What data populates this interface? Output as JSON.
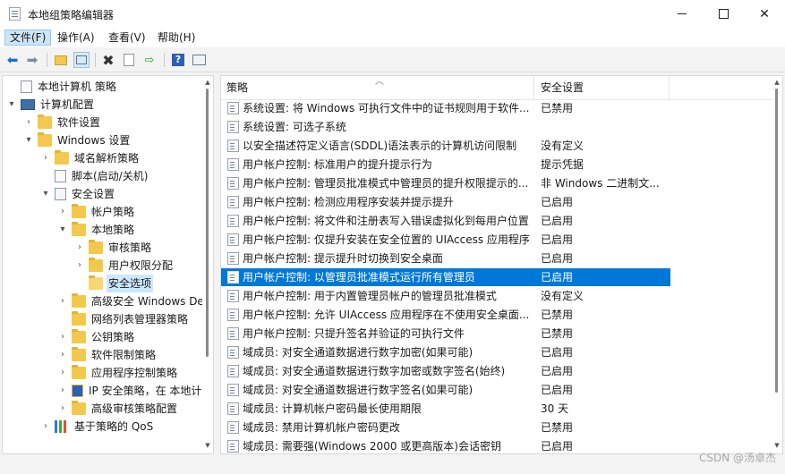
{
  "window": {
    "title": "本地组策略编辑器"
  },
  "menu": [
    "文件(F)",
    "操作(A)",
    "查看(V)",
    "帮助(H)"
  ],
  "toolbar": [
    "back-icon",
    "forward-icon",
    "up-folder-icon",
    "show-tree-icon",
    "delete-icon",
    "properties-icon",
    "export-icon",
    "help-icon",
    "view-icon"
  ],
  "tree": [
    {
      "label": "本地计算机 策略",
      "depth": 0,
      "expander": "",
      "icon": "policy-doc-icon"
    },
    {
      "label": "计算机配置",
      "depth": 0,
      "expander": "▾",
      "icon": "computer-icon"
    },
    {
      "label": "软件设置",
      "depth": 1,
      "expander": "›",
      "icon": "folder-icon"
    },
    {
      "label": "Windows 设置",
      "depth": 1,
      "expander": "▾",
      "icon": "folder-icon"
    },
    {
      "label": "域名解析策略",
      "depth": 2,
      "expander": "›",
      "icon": "folder-icon"
    },
    {
      "label": "脚本(启动/关机)",
      "depth": 2,
      "expander": "",
      "icon": "script-icon"
    },
    {
      "label": "安全设置",
      "depth": 2,
      "expander": "▾",
      "icon": "security-icon"
    },
    {
      "label": "帐户策略",
      "depth": 3,
      "expander": "›",
      "icon": "folder-icon"
    },
    {
      "label": "本地策略",
      "depth": 3,
      "expander": "▾",
      "icon": "folder-icon"
    },
    {
      "label": "审核策略",
      "depth": 4,
      "expander": "›",
      "icon": "folder-icon"
    },
    {
      "label": "用户权限分配",
      "depth": 4,
      "expander": "›",
      "icon": "folder-icon"
    },
    {
      "label": "安全选项",
      "depth": 4,
      "expander": "",
      "icon": "folder-open-icon",
      "selected": true
    },
    {
      "label": "高级安全 Windows De",
      "depth": 3,
      "expander": "›",
      "icon": "folder-icon"
    },
    {
      "label": "网络列表管理器策略",
      "depth": 3,
      "expander": "",
      "icon": "folder-icon"
    },
    {
      "label": "公钥策略",
      "depth": 3,
      "expander": "›",
      "icon": "folder-icon"
    },
    {
      "label": "软件限制策略",
      "depth": 3,
      "expander": "›",
      "icon": "folder-icon"
    },
    {
      "label": "应用程序控制策略",
      "depth": 3,
      "expander": "›",
      "icon": "folder-icon"
    },
    {
      "label": "IP 安全策略，在 本地计",
      "depth": 3,
      "expander": "›",
      "icon": "ipsec-icon"
    },
    {
      "label": "高级审核策略配置",
      "depth": 3,
      "expander": "›",
      "icon": "folder-icon"
    },
    {
      "label": "基于策略的 QoS",
      "depth": 2,
      "expander": "›",
      "icon": "qos-chart-icon"
    }
  ],
  "list": {
    "col_policy": "策略",
    "col_setting": "安全设置",
    "rows": [
      {
        "policy": "系统设置: 将 Windows 可执行文件中的证书规则用于软件...",
        "setting": "已禁用"
      },
      {
        "policy": "系统设置: 可选子系统",
        "setting": ""
      },
      {
        "policy": "以安全描述符定义语言(SDDL)语法表示的计算机访问限制",
        "setting": "没有定义"
      },
      {
        "policy": "用户帐户控制: 标准用户的提升提示行为",
        "setting": "提示凭据"
      },
      {
        "policy": "用户帐户控制: 管理员批准模式中管理员的提升权限提示的...",
        "setting": "非 Windows 二进制文..."
      },
      {
        "policy": "用户帐户控制: 检测应用程序安装并提示提升",
        "setting": "已启用"
      },
      {
        "policy": "用户帐户控制: 将文件和注册表写入错误虚拟化到每用户位置",
        "setting": "已启用"
      },
      {
        "policy": "用户帐户控制: 仅提升安装在安全位置的 UIAccess 应用程序",
        "setting": "已启用"
      },
      {
        "policy": "用户帐户控制: 提示提升时切换到安全桌面",
        "setting": "已启用"
      },
      {
        "policy": "用户帐户控制: 以管理员批准模式运行所有管理员",
        "setting": "已启用",
        "selected": true
      },
      {
        "policy": "用户帐户控制: 用于内置管理员帐户的管理员批准模式",
        "setting": "没有定义"
      },
      {
        "policy": "用户帐户控制: 允许 UIAccess 应用程序在不使用安全桌面...",
        "setting": "已禁用"
      },
      {
        "policy": "用户帐户控制: 只提升签名并验证的可执行文件",
        "setting": "已禁用"
      },
      {
        "policy": "域成员: 对安全通道数据进行数字加密(如果可能)",
        "setting": "已启用"
      },
      {
        "policy": "域成员: 对安全通道数据进行数字加密或数字签名(始终)",
        "setting": "已启用"
      },
      {
        "policy": "域成员: 对安全通道数据进行数字签名(如果可能)",
        "setting": "已启用"
      },
      {
        "policy": "域成员: 计算机帐户密码最长使用期限",
        "setting": "30 天"
      },
      {
        "policy": "域成员: 禁用计算机帐户密码更改",
        "setting": "已禁用"
      },
      {
        "policy": "域成员: 需要强(Windows 2000 或更高版本)会话密钥",
        "setting": "已启用"
      }
    ]
  },
  "watermark": "CSDN @汤卓杰"
}
